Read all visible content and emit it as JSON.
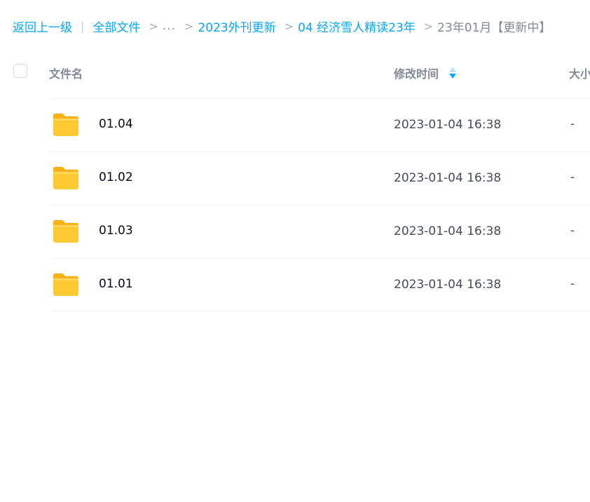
{
  "breadcrumb": {
    "back_label": "返回上一级",
    "pipe": "|",
    "root_label": "全部文件",
    "separator": ">",
    "ellipsis": "...",
    "crumbs": [
      "2023外刊更新",
      "04 经济雪人精读23年"
    ],
    "current": "23年01月【更新中】"
  },
  "table": {
    "headers": {
      "name": "文件名",
      "modified": "修改时间",
      "size": "大小"
    },
    "sort": {
      "column": "modified",
      "direction": "desc"
    },
    "rows": [
      {
        "icon": "folder-icon",
        "name": "01.04",
        "modified": "2023-01-04 16:38",
        "size": "-"
      },
      {
        "icon": "folder-icon",
        "name": "01.02",
        "modified": "2023-01-04 16:38",
        "size": "-"
      },
      {
        "icon": "folder-icon",
        "name": "01.03",
        "modified": "2023-01-04 16:38",
        "size": "-"
      },
      {
        "icon": "folder-icon",
        "name": "01.01",
        "modified": "2023-01-04 16:38",
        "size": "-"
      }
    ]
  },
  "colors": {
    "link": "#06a7ff",
    "header_text": "#818999",
    "name_text": "#03081a",
    "meta_text": "#454d5a",
    "folder_body": "#ffc933",
    "folder_tab": "#f9b115"
  }
}
